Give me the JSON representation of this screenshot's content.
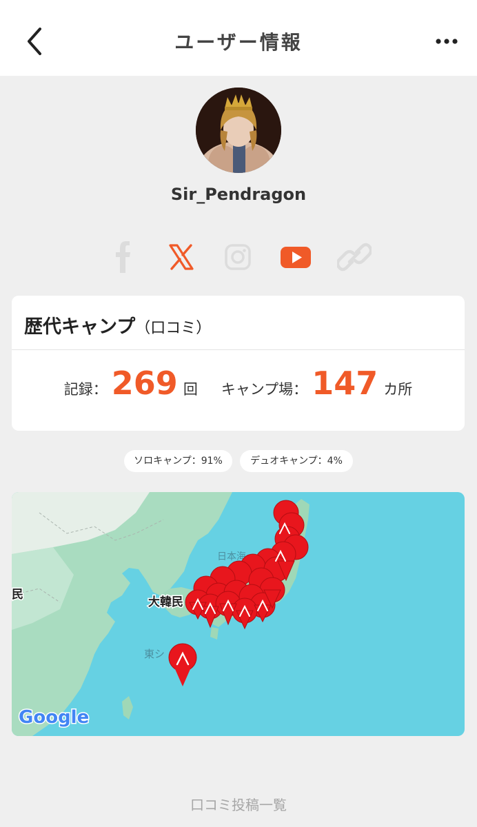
{
  "header": {
    "title": "ユーザー情報",
    "back_icon": "chevron-left-icon",
    "more_icon": "more-horizontal-icon"
  },
  "profile": {
    "username": "Sir_Pendragon",
    "avatar": "avatar-image"
  },
  "social_links": [
    {
      "name": "facebook-icon",
      "active": false
    },
    {
      "name": "x-icon",
      "active": true
    },
    {
      "name": "instagram-icon",
      "active": false
    },
    {
      "name": "youtube-icon",
      "active": true
    },
    {
      "name": "link-icon",
      "active": false
    }
  ],
  "history_card": {
    "title": "歴代キャンプ",
    "subtitle": "（口コミ）",
    "records_label": "記録：",
    "records_value": "269",
    "records_unit": "回",
    "sites_label": "キャンプ場：",
    "sites_value": "147",
    "sites_unit": "カ所"
  },
  "tags": [
    {
      "label": "ソロキャンプ：91%"
    },
    {
      "label": "デュオキャンプ：4%"
    }
  ],
  "map": {
    "labels": {
      "sea_japan": "日本海",
      "korea": "大韓民",
      "east_china": "東シ",
      "left_edge": "民",
      "logo": "Google"
    },
    "marker_count": 2
  },
  "footer": {
    "link_label": "口コミ投稿一覧"
  },
  "colors": {
    "accent": "#f05a28",
    "inactive_icon": "#d9d9d9",
    "marker": "#e8161d",
    "sea": "#66d1e3",
    "land": "#8fd1b0"
  }
}
